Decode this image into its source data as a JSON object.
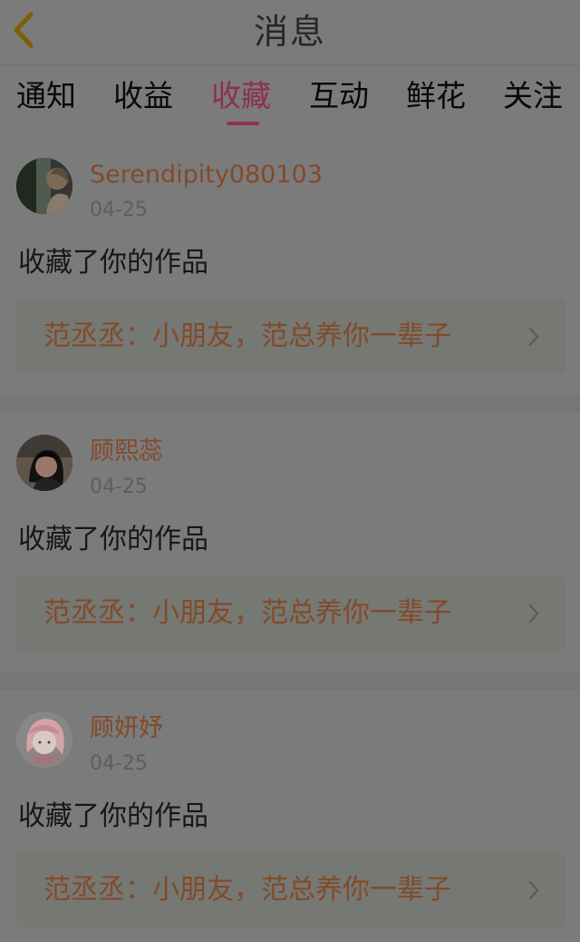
{
  "app": {
    "title": "消息"
  },
  "icons": {
    "back": "back-chevron-icon",
    "next": "chevron-right-icon"
  },
  "colors": {
    "overlay_background": "#7b7b7b",
    "active_tab": "#8d2f52",
    "username": "#834a28",
    "back_icon": "#7f5e00"
  },
  "tabs": [
    {
      "label": "通知",
      "active": false
    },
    {
      "label": "收益",
      "active": false
    },
    {
      "label": "收藏",
      "active": true
    },
    {
      "label": "互动",
      "active": false
    },
    {
      "label": "鲜花",
      "active": false
    },
    {
      "label": "关注",
      "active": false
    }
  ],
  "messages": [
    {
      "user": "Serendipity080103",
      "date": "04-25",
      "action": "收藏了你的作品",
      "work": "范丞丞：小朋友，范总养你一辈子",
      "avatar": "photo avatar"
    },
    {
      "user": "顾熙蕊",
      "date": "04-25",
      "action": "收藏了你的作品",
      "work": "范丞丞：小朋友，范总养你一辈子",
      "avatar": "photo avatar"
    },
    {
      "user": "顾妍妤",
      "date": "04-25",
      "action": "收藏了你的作品",
      "work": "范丞丞：小朋友，范总养你一辈子",
      "avatar": "illustrated avatar"
    }
  ]
}
